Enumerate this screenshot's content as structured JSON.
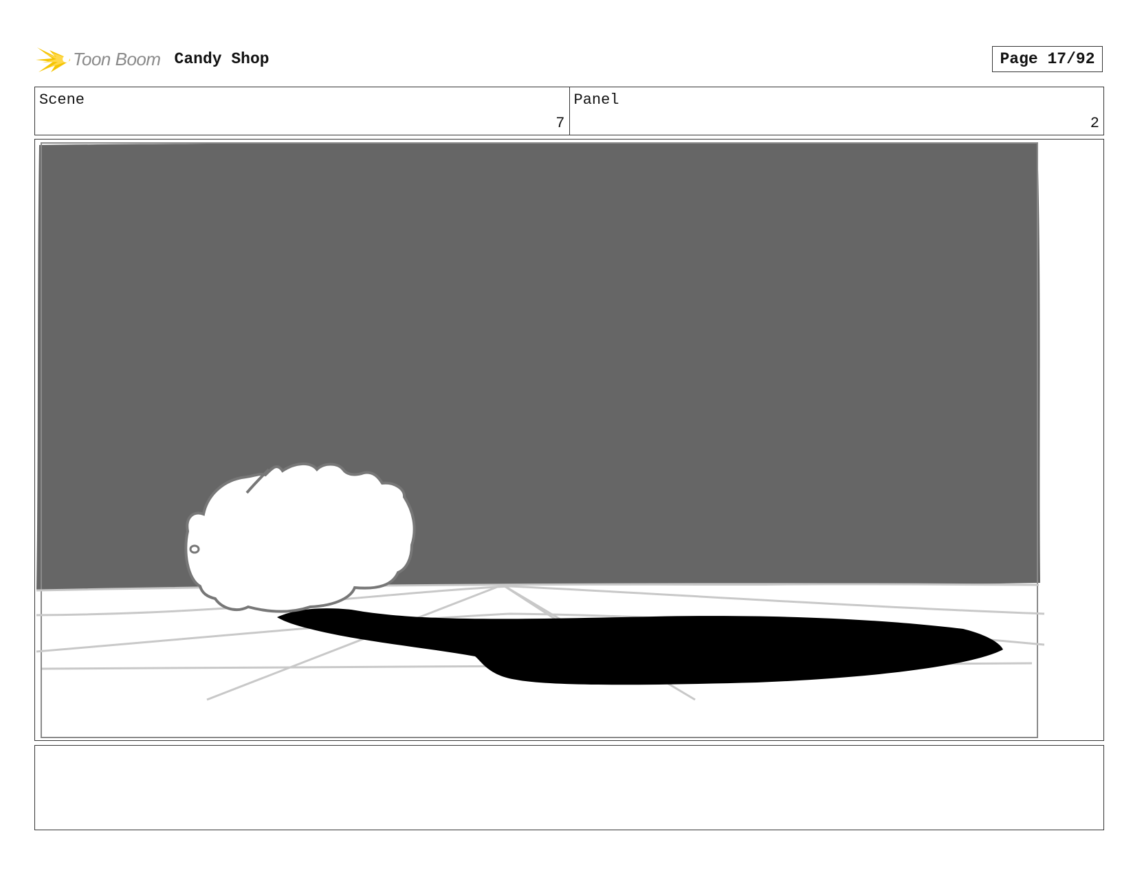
{
  "header": {
    "logo_text": "Toon Boom",
    "project_title": "Candy Shop",
    "page_label": "Page 17/92"
  },
  "info": {
    "scene_label": "Scene",
    "scene_value": "7",
    "panel_label": "Panel",
    "panel_value": "2"
  },
  "notes": {
    "text": ""
  },
  "colors": {
    "backdrop": "#666666",
    "shadow": "#000000",
    "floor_lines": "#c8c8c8",
    "outline": "#777777",
    "logo_yellow": "#f5c400"
  }
}
